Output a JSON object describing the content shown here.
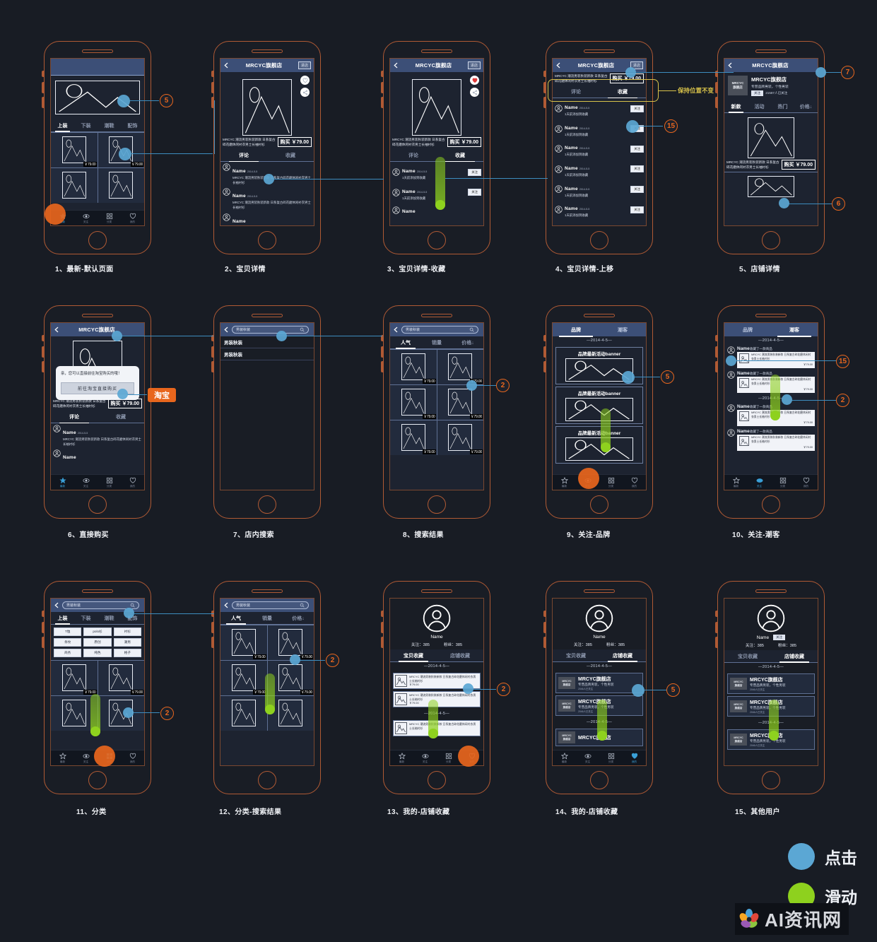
{
  "common": {
    "brand": "MRCYC旗舰店",
    "enter_shop": "进店",
    "product_desc": "MRCYC 潮流男装秋装新款 日系复古碎花磨休闲衬衣男士长袖衬衫",
    "price": "￥79.00",
    "buy_label": "购买 ￥79.00",
    "back_icon": "chevron-left-icon",
    "search_icon": "search-icon",
    "tab_comment": "评论",
    "tab_collect": "收藏",
    "comment_name": "Name",
    "comment_date": "2014-5-5",
    "collect_sub": "1天前添加到收藏",
    "follow_label": "关注",
    "search_value": "男装秋装",
    "date_divider": "—2014-4-5—"
  },
  "tabbar": {
    "items": [
      {
        "label": "最新",
        "icon": "star-icon"
      },
      {
        "label": "关注",
        "icon": "eye-icon"
      },
      {
        "label": "分类",
        "icon": "grid-icon"
      },
      {
        "label": "我的",
        "icon": "heart-icon"
      }
    ]
  },
  "category_tabs": [
    "上装",
    "下装",
    "潮鞋",
    "配饰"
  ],
  "shop_tabs": [
    "新款",
    "活动",
    "热门",
    "价格↓"
  ],
  "sort_tabs": [
    "人气",
    "销量",
    "价格↓"
  ],
  "follow_tabs": [
    "品牌",
    "潮客"
  ],
  "profile_tabs": [
    "宝贝收藏",
    "店铺收藏"
  ],
  "chips": [
    "T恤",
    "polo衫",
    "衬衫",
    "条纹",
    "原创",
    "潮男",
    "商务",
    "纯色",
    "格子"
  ],
  "shop": {
    "name": "MRCYC旗舰店",
    "logo": "MRCYC\n旗舰店",
    "logo_l1": "MRCYC",
    "logo_l2": "旗舰店",
    "slogan": "专营品牌男装，个性男装",
    "follow_btn": "关注",
    "follow_count": "21587人已关注",
    "item_follow_count": "2046人已关注"
  },
  "dialog": {
    "text": "亲，您可以直接前往淘宝购买的哦！",
    "button": "前往淘宝直接购买",
    "chip": "淘宝"
  },
  "callout": {
    "keep_position": "保持位置不变"
  },
  "search": {
    "suggestions": [
      "男装秋装",
      "男装秋装"
    ]
  },
  "banner": {
    "title": "品牌最新活动banner"
  },
  "feed": {
    "name": "Name",
    "action": "收藏了一款商品"
  },
  "profile": {
    "name": "Name",
    "follow_stat": "关注：385",
    "fans_stat": "粉丝：385",
    "follow_btn": "关注"
  },
  "captions": [
    "1、最新-默认页面",
    "2、宝贝详情",
    "3、宝贝详情-收藏",
    "4、宝贝详情-上移",
    "5、店铺详情",
    "6、直接购买",
    "7、店内搜索",
    "8、搜索结果",
    "9、关注-品牌",
    "10、关注-潮客",
    "11、分类",
    "12、分类-搜索结果",
    "13、我的-店铺收藏",
    "14、我的-店铺收藏",
    "15、其他用户"
  ],
  "badges": [
    "5",
    "7",
    "6",
    "15",
    "2",
    "5",
    "2",
    "15",
    "2",
    "2",
    "2",
    "5"
  ],
  "legend": {
    "click": "点击",
    "swipe": "滑动",
    "click_color": "#5ba7d4",
    "swipe_color": "#8ed11e"
  },
  "watermark": {
    "text": "AI资讯网"
  }
}
